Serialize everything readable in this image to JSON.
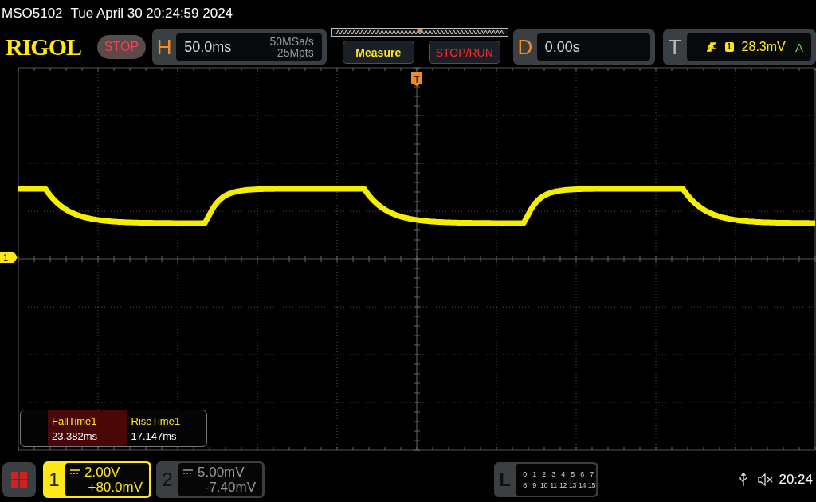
{
  "status_line": {
    "model": "MSO5102",
    "datetime": "Tue April 30 20:24:59 2024"
  },
  "header": {
    "logo": "RIGOL",
    "run_state": "STOP",
    "horizontal": {
      "label": "H",
      "timebase": "50.0ms",
      "sample_rate": "50MSa/s",
      "memory_depth": "25Mpts"
    },
    "buttons": [
      {
        "label": "Measure",
        "kind": "measure"
      },
      {
        "label": "STOP/RUN",
        "kind": "run"
      }
    ],
    "delay": {
      "label": "D",
      "value": "0.00s"
    },
    "trigger": {
      "label": "T",
      "source": "1",
      "level": "28.3mV",
      "mode": "A"
    }
  },
  "display": {
    "trigger_marker": "T",
    "channel_marker": "1",
    "measurements": [
      {
        "name": "FallTime1",
        "value": "23.382ms",
        "selected": true
      },
      {
        "name": "RiseTime1",
        "value": "17.147ms",
        "selected": false
      }
    ]
  },
  "bottom_bar": {
    "channels": [
      {
        "number": "1",
        "scale": "2.00V",
        "offset": "+80.0mV",
        "selected": true
      },
      {
        "number": "2",
        "scale": "5.00mV",
        "offset": "-7.40mV",
        "selected": false
      }
    ],
    "logic": {
      "label": "L",
      "rows": [
        [
          "0",
          "1",
          "2",
          "3",
          "4",
          "5",
          "6",
          "7"
        ],
        [
          "8",
          "9",
          "10",
          "11",
          "12",
          "13",
          "14",
          "15"
        ]
      ]
    },
    "clock": "20:24"
  }
}
